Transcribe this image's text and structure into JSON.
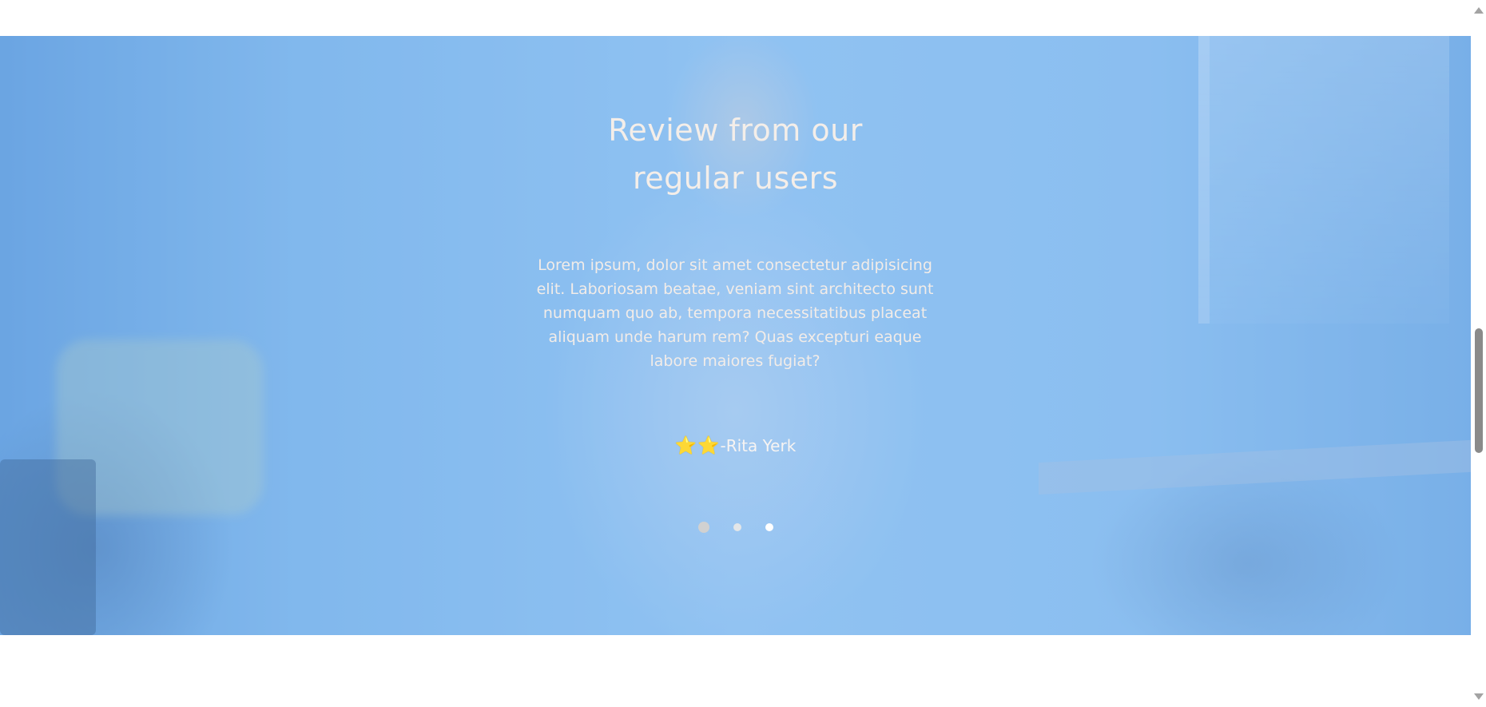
{
  "testimonial": {
    "title_line1": "Review from our",
    "title_line2": "regular users",
    "review_text": "Lorem ipsum, dolor sit amet consectetur adipisicing elit. Laboriosam beatae, veniam sint architecto sunt numquam quo ab, tempora necessitatibus placeat aliquam unde harum rem? Quas excepturi eaque labore maiores fugiat?",
    "stars": "⭐⭐",
    "rating": 2,
    "author": "-Rita Yerk",
    "carousel": {
      "total_slides": 3,
      "active_index": 0
    }
  },
  "colors": {
    "overlay_blue": "#8ec3f2",
    "text": "#f4eee9",
    "star": "#f2cf2a"
  },
  "icons": {
    "scroll_up": "triangle-up-icon",
    "scroll_down": "triangle-down-icon"
  }
}
